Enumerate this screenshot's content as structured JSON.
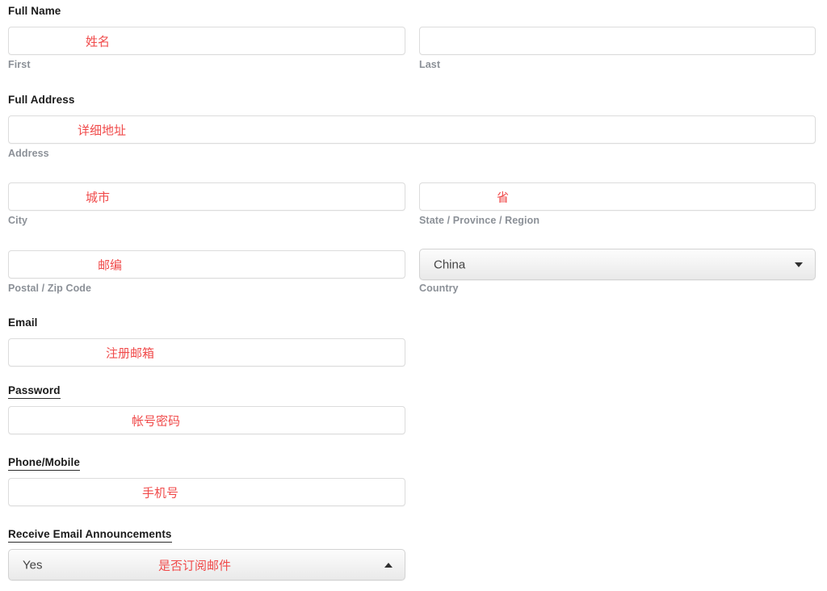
{
  "form": {
    "fields": [
      {
        "id": "full-name",
        "label": "Full Name",
        "label_underlined": false,
        "inputs": [
          {
            "id": "first-name",
            "sub_label": "First",
            "value": "",
            "annotation": "姓名"
          },
          {
            "id": "last-name",
            "sub_label": "Last",
            "value": "",
            "annotation": ""
          }
        ]
      },
      {
        "id": "full-address",
        "label": "Full Address",
        "label_underlined": false,
        "inputs": [
          {
            "id": "address",
            "sub_label": "Address",
            "value": "",
            "annotation": "详细地址"
          },
          {
            "id": "city",
            "sub_label": "City",
            "value": "",
            "annotation": "城市"
          },
          {
            "id": "state",
            "sub_label": "State / Province / Region",
            "value": "",
            "annotation": "省"
          },
          {
            "id": "postal-code",
            "sub_label": "Postal / Zip Code",
            "value": "",
            "annotation": "邮编"
          },
          {
            "id": "country",
            "sub_label": "Country",
            "value": "China",
            "annotation": "",
            "type": "select",
            "arrow": "down"
          }
        ]
      },
      {
        "id": "email",
        "label": "Email",
        "label_underlined": false,
        "inputs": [
          {
            "id": "email-input",
            "sub_label": "",
            "value": "",
            "annotation": "注册邮箱"
          }
        ]
      },
      {
        "id": "password",
        "label": "Password",
        "label_underlined": true,
        "inputs": [
          {
            "id": "password-input",
            "sub_label": "",
            "value": "",
            "annotation": "帐号密码"
          }
        ]
      },
      {
        "id": "phone-mobile",
        "label": "Phone/Mobile",
        "label_underlined": true,
        "inputs": [
          {
            "id": "phone-input",
            "sub_label": "",
            "value": "",
            "annotation": "手机号"
          }
        ]
      },
      {
        "id": "receive-email-announcements",
        "label": "Receive Email Announcements",
        "label_underlined": true,
        "inputs": [
          {
            "id": "announcements-select",
            "sub_label": "",
            "value": "Yes",
            "annotation": "是否订阅邮件",
            "type": "select",
            "arrow": "up"
          }
        ]
      }
    ]
  },
  "colors": {
    "annotation_red": "#f04a4a",
    "label_dark": "#1a1a1a",
    "sub_label_gray": "#8b9097",
    "input_border": "#dcdcdc",
    "select_border": "#d2d2d2",
    "page_background": "#ffffff"
  }
}
